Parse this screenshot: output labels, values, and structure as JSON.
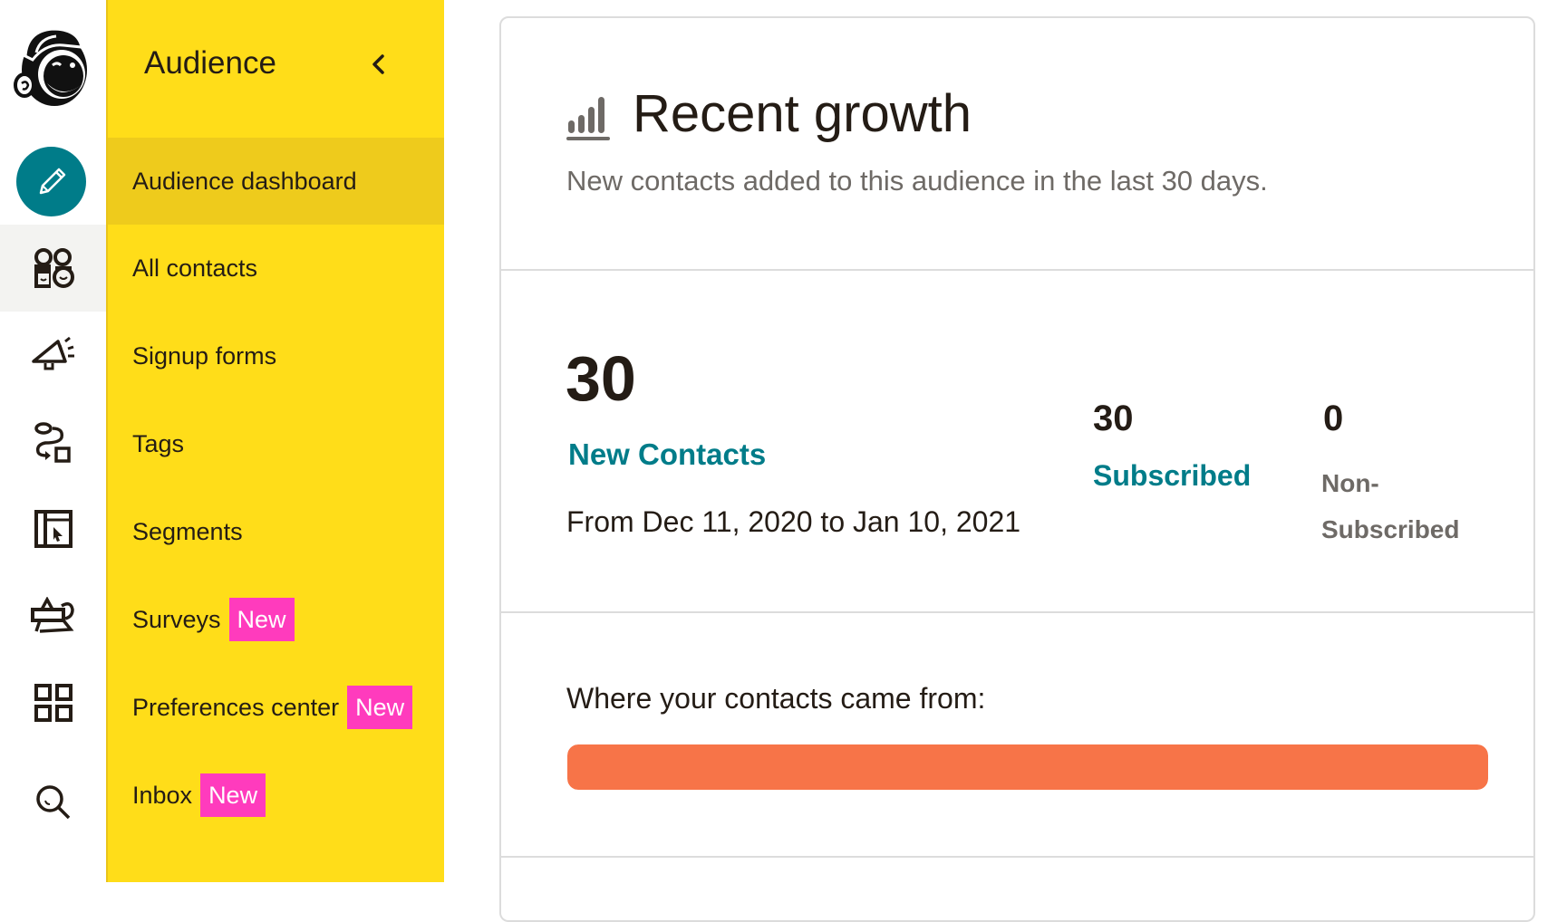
{
  "rail": {
    "logo": "mailchimp-freddie-logo",
    "create_button": "pencil-icon",
    "items": [
      {
        "icon": "audience-icon",
        "active": true
      },
      {
        "icon": "campaigns-megaphone-icon",
        "active": false
      },
      {
        "icon": "automations-icon",
        "active": false
      },
      {
        "icon": "website-icon",
        "active": false
      },
      {
        "icon": "content-studio-icon",
        "active": false
      },
      {
        "icon": "integrations-grid-icon",
        "active": false
      },
      {
        "icon": "search-icon",
        "active": false
      }
    ]
  },
  "nav": {
    "header": "Audience",
    "collapse_icon": "chevron-left-icon",
    "items": [
      {
        "label": "Audience dashboard",
        "active": true,
        "badge": null
      },
      {
        "label": "All contacts",
        "active": false,
        "badge": null
      },
      {
        "label": "Signup forms",
        "active": false,
        "badge": null
      },
      {
        "label": "Tags",
        "active": false,
        "badge": null
      },
      {
        "label": "Segments",
        "active": false,
        "badge": null
      },
      {
        "label": "Surveys",
        "active": false,
        "badge": "New"
      },
      {
        "label": "Preferences center",
        "active": false,
        "badge": "New"
      },
      {
        "label": "Inbox",
        "active": false,
        "badge": "New"
      }
    ]
  },
  "card": {
    "title_icon": "bar-chart-icon",
    "title": "Recent growth",
    "subtitle": "New contacts added to this audience in the last 30 days.",
    "new_contacts": {
      "value": "30",
      "label": "New Contacts"
    },
    "date_range": "From Dec 11, 2020 to Jan 10, 2021",
    "subscribed": {
      "value": "30",
      "label": "Subscribed"
    },
    "non_subscribed": {
      "value": "0",
      "label": "Non-Subscribed",
      "label_line1": "Non-",
      "label_line2": "Subscribed"
    },
    "sources": {
      "label": "Where your contacts came from:",
      "segments": [
        {
          "share_percent": 100,
          "color": "#f77448"
        }
      ]
    }
  },
  "colors": {
    "nav_yellow": "#ffdd19",
    "nav_active": "#eecb1c",
    "brand_teal": "#007c89",
    "badge_pink": "#ff3bbd",
    "source_orange": "#f77448"
  }
}
